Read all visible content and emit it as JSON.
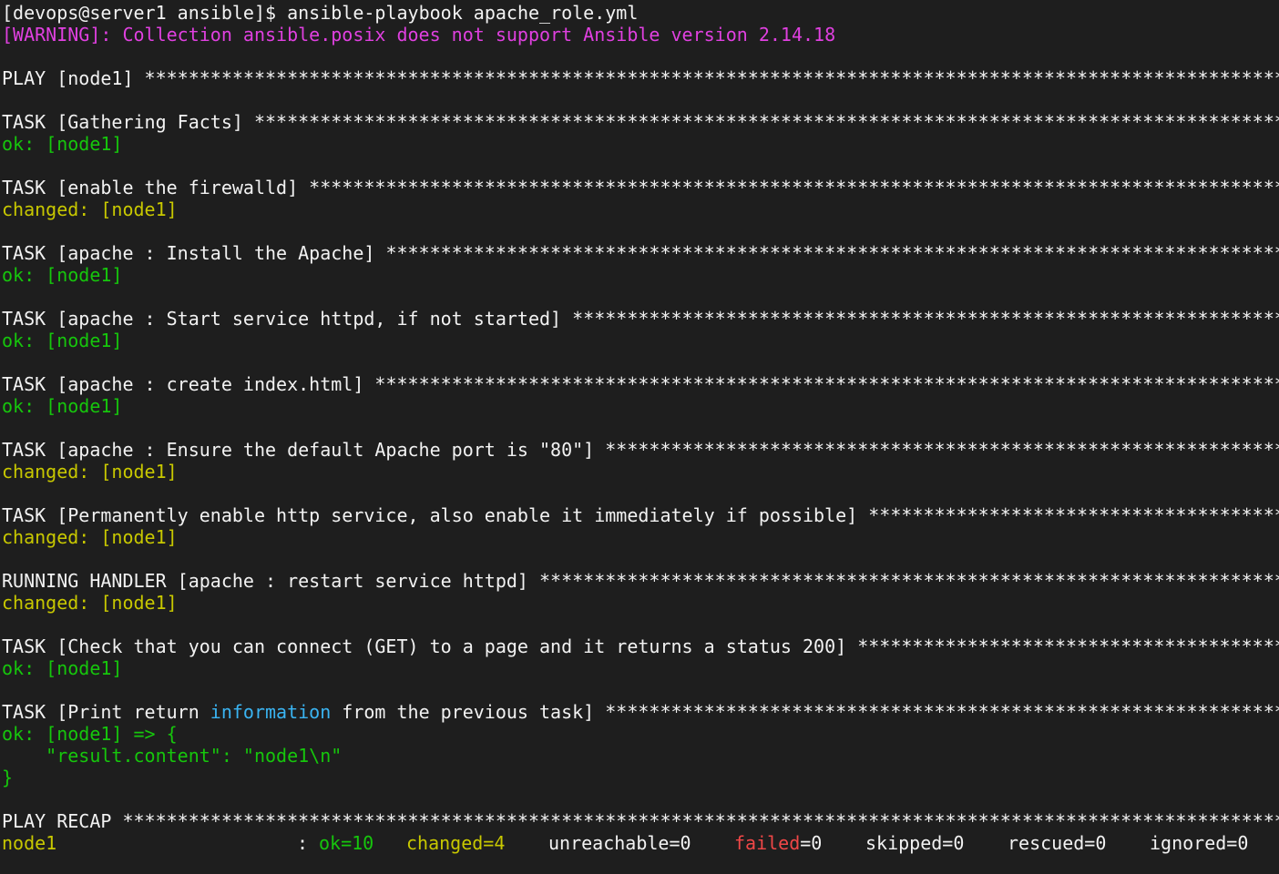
{
  "terminal": {
    "prompt": "[devops@server1 ansible]$ ",
    "command": "ansible-playbook apache_role.yml",
    "warning": "[WARNING]: Collection ansible.posix does not support Ansible version 2.14.18",
    "play_header": "PLAY [node1] ",
    "tasks": [
      {
        "header": "TASK [Gathering Facts] ",
        "status": "ok",
        "result": "ok: [node1]"
      },
      {
        "header": "TASK [enable the firewalld] ",
        "status": "changed",
        "result": "changed: [node1]"
      },
      {
        "header": "TASK [apache : Install the Apache] ",
        "status": "ok",
        "result": "ok: [node1]"
      },
      {
        "header": "TASK [apache : Start service httpd, if not started] ",
        "status": "ok",
        "result": "ok: [node1]"
      },
      {
        "header": "TASK [apache : create index.html] ",
        "status": "ok",
        "result": "ok: [node1]"
      },
      {
        "header": "TASK [apache : Ensure the default Apache port is \"80\"] ",
        "status": "changed",
        "result": "changed: [node1]"
      },
      {
        "header": "TASK [Permanently enable http service, also enable it immediately if possible] ",
        "status": "changed",
        "result": "changed: [node1]"
      },
      {
        "header": "RUNNING HANDLER [apache : restart service httpd] ",
        "status": "changed",
        "result": "changed: [node1]"
      },
      {
        "header": "TASK [Check that you can connect (GET) to a page and it returns a status 200] ",
        "status": "ok",
        "result": "ok: [node1]"
      }
    ],
    "last_task": {
      "header_pre": "TASK [Print return ",
      "header_highlight": "information",
      "header_post": " from the previous task] ",
      "result_open": "ok: [node1] => {",
      "result_body": "    \"result.content\": \"node1\\n\"",
      "result_close": "}"
    },
    "recap_header": "PLAY RECAP ",
    "recap": {
      "host": "node1",
      "sep": ": ",
      "ok": "ok=10",
      "changed": "changed=4",
      "unreachable": "unreachable=0",
      "failed_label": "failed",
      "failed_value": "=0",
      "skipped": "skipped=0",
      "rescued": "rescued=0",
      "ignored": "ignored=0"
    },
    "colors": {
      "background": "#1e1e1e",
      "text": "#f2f2f2",
      "warning": "#e040e0",
      "ok": "#16c60c",
      "changed": "#c8c800",
      "failed": "#f04747",
      "highlight": "#3ab4f2"
    }
  }
}
